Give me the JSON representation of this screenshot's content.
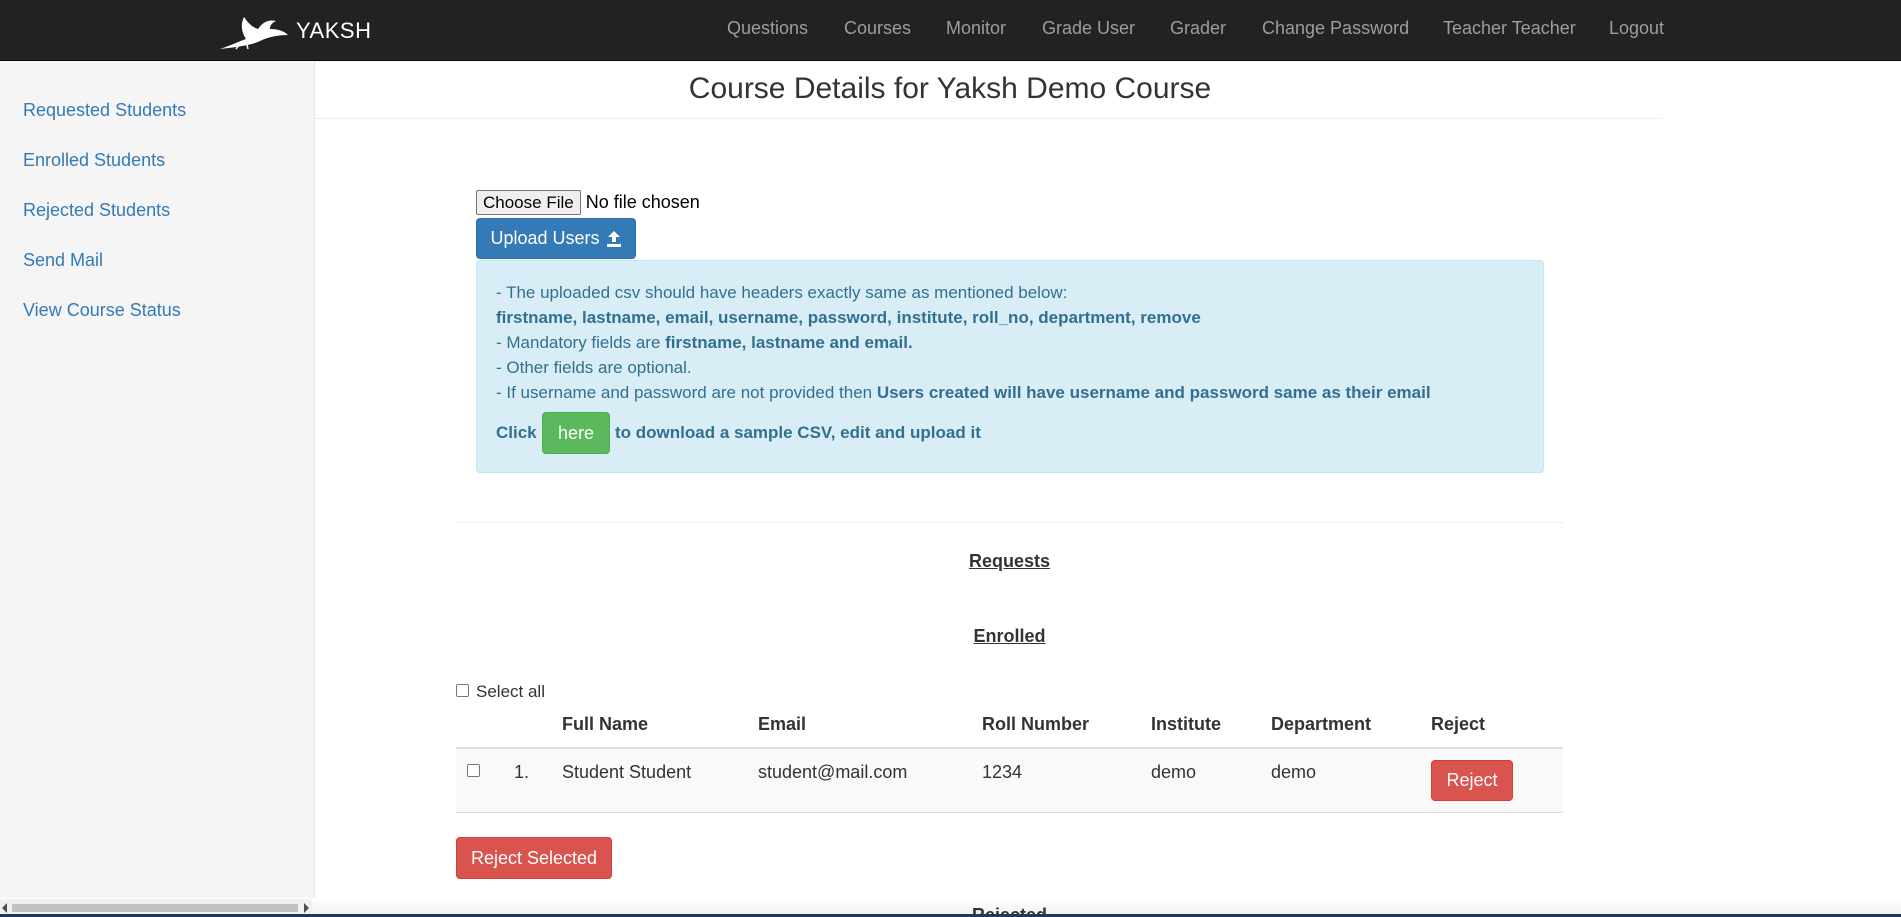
{
  "navbar": {
    "brand": "YAKSH",
    "links": [
      "Questions",
      "Courses",
      "Monitor",
      "Grade User",
      "Grader",
      "Change Password",
      "Teacher Teacher",
      "Logout"
    ]
  },
  "sidebar": {
    "items": [
      {
        "label": "Requested Students"
      },
      {
        "label": "Enrolled Students"
      },
      {
        "label": "Rejected Students"
      },
      {
        "label": "Send Mail"
      },
      {
        "label": "View Course Status"
      }
    ]
  },
  "main": {
    "title": "Course Details for Yaksh Demo Course",
    "file_input": {
      "button": "Choose File",
      "status": "No file chosen"
    },
    "upload_button": "Upload Users",
    "info": {
      "line1": "- The uploaded csv should have headers exactly same as mentioned below:",
      "headers": "firstname, lastname, email, username, password, institute, roll_no, department, remove",
      "line3_prefix": "- Mandatory fields are ",
      "line3_bold": "firstname, lastname and email.",
      "line4": "- Other fields are optional.",
      "line5_prefix": "- If username and password are not provided then ",
      "line5_bold": "Users created will have username and password same as their email",
      "click_prefix": "Click",
      "here_button": "here",
      "click_suffix": "to download a sample CSV, edit and upload it"
    },
    "requests_heading": "Requests",
    "enrolled_heading": "Enrolled",
    "select_all": "Select all",
    "table": {
      "headers": [
        "Full Name",
        "Email",
        "Roll Number",
        "Institute",
        "Department",
        "Reject"
      ],
      "rows": [
        {
          "index": "1.",
          "full_name": "Student Student",
          "email": "student@mail.com",
          "roll_number": "1234",
          "institute": "demo",
          "department": "demo",
          "reject": "Reject"
        }
      ]
    },
    "reject_selected": "Reject Selected",
    "rejected_heading": "Rejected"
  },
  "colors": {
    "navbar_bg": "#222222",
    "link": "#337ab7",
    "primary": "#337ab7",
    "danger": "#d9534f",
    "success": "#5cb85c",
    "info_bg": "#d9edf7",
    "info_text": "#31708f"
  },
  "icons": {
    "brand": "crane-bird-logo",
    "upload": "upload-icon"
  }
}
